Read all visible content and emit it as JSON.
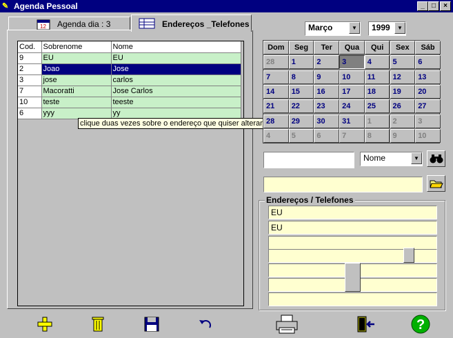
{
  "window": {
    "title": "Agenda Pessoal",
    "minimize_glyph": "_",
    "maximize_glyph": "□",
    "close_glyph": "×"
  },
  "tabs": [
    {
      "label": "Agenda dia : 3",
      "icon": "calendar-icon",
      "active": false
    },
    {
      "label": "Endereços _Telefones",
      "icon": "address-book-icon",
      "active": true
    }
  ],
  "grid": {
    "columns": [
      "Cod.",
      "Sobrenome",
      "Nome"
    ],
    "rows": [
      {
        "cod": "9",
        "sobrenome": "EU",
        "nome": "EU",
        "selected": false
      },
      {
        "cod": "2",
        "sobrenome": "Joao",
        "nome": "Jose",
        "selected": true
      },
      {
        "cod": "3",
        "sobrenome": "jose",
        "nome": "carlos",
        "selected": false
      },
      {
        "cod": "7",
        "sobrenome": "Macoratti",
        "nome": "Jose Carlos",
        "selected": false
      },
      {
        "cod": "10",
        "sobrenome": "teste",
        "nome": "teeste",
        "selected": false
      },
      {
        "cod": "6",
        "sobrenome": "yyy",
        "nome": "yy",
        "selected": false
      }
    ],
    "tooltip": "clique duas vezes sobre o endereço  que quiser alterar"
  },
  "calendar": {
    "month": "Março",
    "year": "1999",
    "weekdays": [
      "Dom",
      "Seg",
      "Ter",
      "Qua",
      "Qui",
      "Sex",
      "Sáb"
    ],
    "weeks": [
      [
        "28",
        "1",
        "2",
        "3",
        "4",
        "5",
        "6"
      ],
      [
        "7",
        "8",
        "9",
        "10",
        "11",
        "12",
        "13"
      ],
      [
        "14",
        "15",
        "16",
        "17",
        "18",
        "19",
        "20"
      ],
      [
        "21",
        "22",
        "23",
        "24",
        "25",
        "26",
        "27"
      ],
      [
        "28",
        "29",
        "30",
        "31",
        "1",
        "2",
        "3"
      ],
      [
        "4",
        "5",
        "6",
        "7",
        "8",
        "9",
        "10"
      ]
    ],
    "today": "3",
    "accent_color": "#000080"
  },
  "search": {
    "value": "",
    "field_select": "Nome",
    "search_icon": "binoculars-icon"
  },
  "path_field": {
    "value": "",
    "open_icon": "folder-open-icon"
  },
  "address": {
    "group_label": "Endereços / Telefones",
    "lines": [
      "EU",
      "EU",
      "",
      "",
      "",
      "",
      ""
    ]
  },
  "toolbar": [
    {
      "name": "add-icon",
      "glyph": "✚",
      "color": "#ffff00"
    },
    {
      "name": "trash-icon",
      "glyph": "🗑",
      "color": "#808000"
    },
    {
      "name": "save-icon",
      "glyph": "💾",
      "color": "#000080"
    },
    {
      "name": "undo-icon",
      "glyph": "↶",
      "color": "#000080"
    },
    {
      "name": "printer-icon",
      "glyph": "🖶",
      "color": "#404040"
    },
    {
      "name": "exit-icon",
      "glyph": "⇥",
      "color": "#000080"
    },
    {
      "name": "help-icon",
      "glyph": "?",
      "color": "#00a000"
    }
  ]
}
